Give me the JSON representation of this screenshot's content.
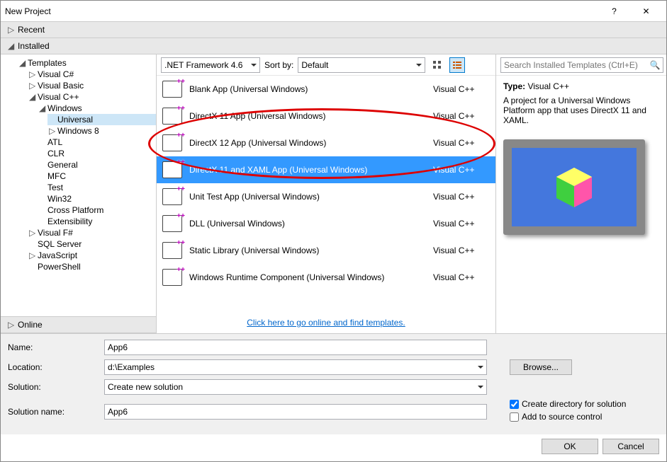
{
  "window": {
    "title": "New Project",
    "help": "?",
    "close": "✕"
  },
  "sidebar": {
    "recent_header": "Recent",
    "installed_header": "Installed",
    "online_header": "Online",
    "templates_root": "Templates",
    "tree": {
      "vcs": "Visual C#",
      "vb": "Visual Basic",
      "vcpp": "Visual C++",
      "windows": "Windows",
      "universal": "Universal",
      "win8": "Windows 8",
      "atl": "ATL",
      "clr": "CLR",
      "general": "General",
      "mfc": "MFC",
      "test": "Test",
      "win32": "Win32",
      "cross": "Cross Platform",
      "ext": "Extensibility",
      "fsharp": "Visual F#",
      "sql": "SQL Server",
      "js": "JavaScript",
      "ps": "PowerShell"
    }
  },
  "toolbar": {
    "framework": ".NET Framework 4.6",
    "sort_label": "Sort by:",
    "sort_value": "Default"
  },
  "templates": [
    {
      "name": "Blank App (Universal Windows)",
      "lang": "Visual C++"
    },
    {
      "name": "DirectX 11 App (Universal Windows)",
      "lang": "Visual C++"
    },
    {
      "name": "DirectX 12 App (Universal Windows)",
      "lang": "Visual C++"
    },
    {
      "name": "DirectX 11 and XAML App (Universal Windows)",
      "lang": "Visual C++"
    },
    {
      "name": "Unit Test App (Universal Windows)",
      "lang": "Visual C++"
    },
    {
      "name": "DLL (Universal Windows)",
      "lang": "Visual C++"
    },
    {
      "name": "Static Library (Universal Windows)",
      "lang": "Visual C++"
    },
    {
      "name": "Windows Runtime Component (Universal Windows)",
      "lang": "Visual C++"
    }
  ],
  "online_link": "Click here to go online and find templates.",
  "search": {
    "placeholder": "Search Installed Templates (Ctrl+E)"
  },
  "details": {
    "type_label": "Type:",
    "type_value": "Visual C++",
    "description": "A project for a Universal Windows Platform app that uses DirectX 11 and XAML."
  },
  "form": {
    "name_label": "Name:",
    "name_value": "App6",
    "location_label": "Location:",
    "location_value": "d:\\Examples",
    "solution_label": "Solution:",
    "solution_value": "Create new solution",
    "solution_name_label": "Solution name:",
    "solution_name_value": "App6",
    "browse": "Browse...",
    "cb_create_dir": "Create directory for solution",
    "cb_source_control": "Add to source control"
  },
  "buttons": {
    "ok": "OK",
    "cancel": "Cancel"
  }
}
